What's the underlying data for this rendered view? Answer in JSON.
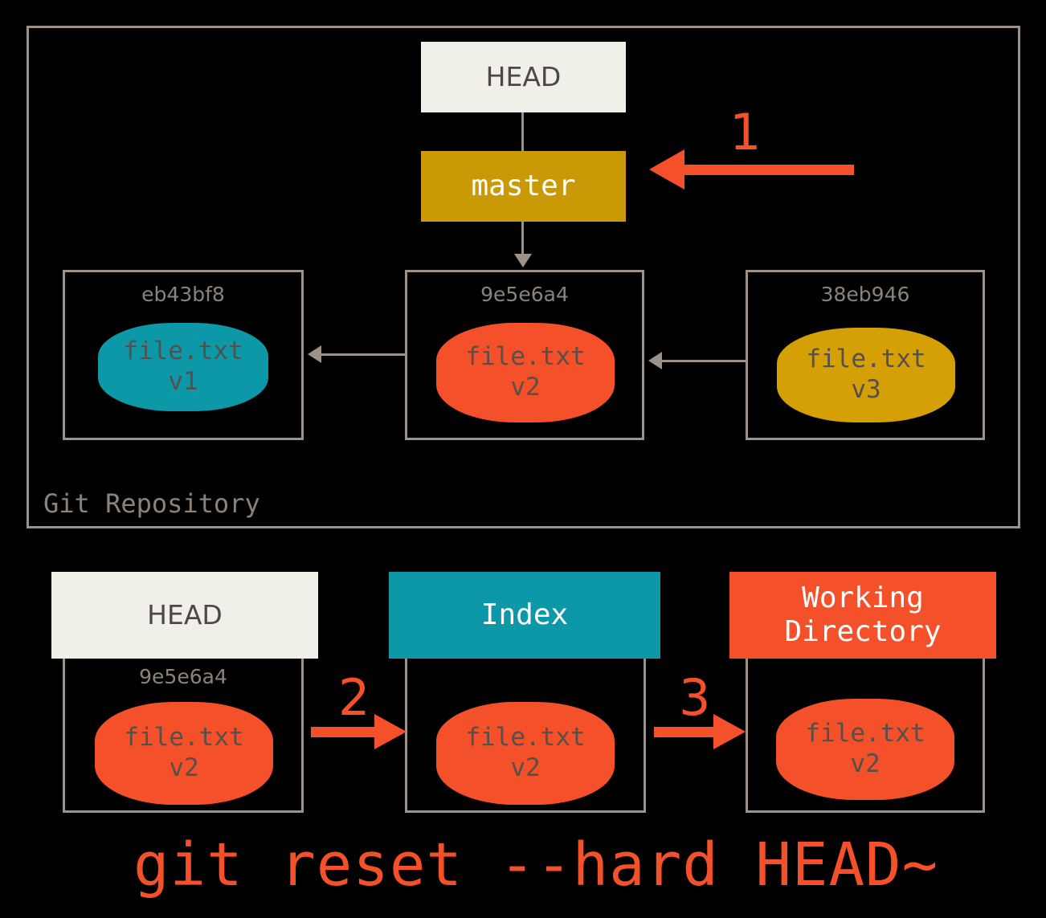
{
  "diagram": {
    "title_command": "git reset --hard HEAD~",
    "repository_label": "Git Repository",
    "colors": {
      "background": "#000000",
      "frame_gray": "#9e9288",
      "head_bg": "#f0f0e8",
      "head_text": "#4d4844",
      "branch_gold": "#c99a06",
      "blob_teal": "#0d98a8",
      "blob_red": "#f4502a",
      "blob_gold": "#d4a006",
      "accent_red": "#f4502a",
      "blob_text": "#55504b",
      "sha_text": "#8c8279"
    }
  },
  "repository": {
    "head_label": "HEAD",
    "branch_label": "master",
    "commits": [
      {
        "sha": "eb43bf8",
        "file": "file.txt",
        "version": "v1",
        "color": "teal"
      },
      {
        "sha": "9e5e6a4",
        "file": "file.txt",
        "version": "v2",
        "color": "red"
      },
      {
        "sha": "38eb946",
        "file": "file.txt",
        "version": "v3",
        "color": "gold"
      }
    ],
    "step_marker": "1"
  },
  "areas": {
    "head": {
      "label": "HEAD",
      "sha": "9e5e6a4",
      "file": "file.txt",
      "version": "v2"
    },
    "index": {
      "label": "Index",
      "file": "file.txt",
      "version": "v2"
    },
    "working_directory": {
      "label_line1": "Working",
      "label_line2": "Directory",
      "file": "file.txt",
      "version": "v2"
    },
    "step_head_to_index": "2",
    "step_index_to_wd": "3"
  }
}
